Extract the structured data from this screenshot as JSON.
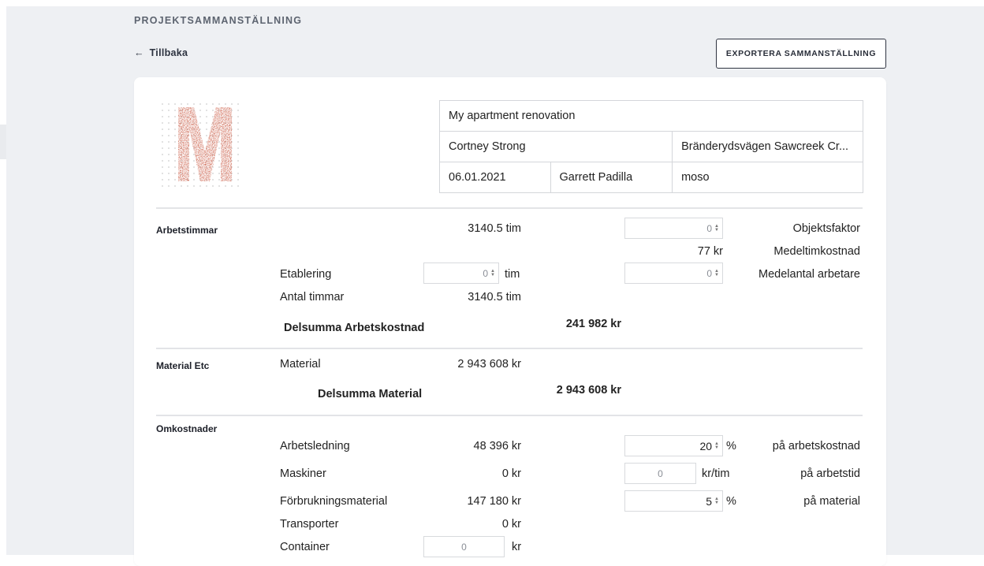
{
  "header": {
    "title": "PROJEKTSAMMANSTÄLLNING",
    "back_label": "Tillbaka",
    "export_label": "EXPORTERA SAMMANSTÄLLNING"
  },
  "colors": {
    "logo": "#c4442a",
    "background": "#eef0f3",
    "card": "#ffffff"
  },
  "project": {
    "name": "My apartment renovation",
    "client": "Cortney Strong",
    "address": "Bränderydsvägen Sawcreek Cr...",
    "date": "06.01.2021",
    "responsible": "Garrett Padilla",
    "code": "moso"
  },
  "arbetstimmar": {
    "section": "Arbetstimmar",
    "hours": "3140.5 tim",
    "objektsfaktor_value": "0",
    "objektsfaktor_label": "Objektsfaktor",
    "medeltim_value": "77 kr",
    "medeltim_label": "Medeltimkostnad",
    "etablering_label": "Etablering",
    "etablering_value": "0",
    "etablering_unit": "tim",
    "medelantal_value": "0",
    "medelantal_label": "Medelantal arbetare",
    "antal_label": "Antal timmar",
    "antal_value": "3140.5 tim",
    "subtotal_label": "Delsumma Arbetskostnad",
    "subtotal_value": "241 982 kr"
  },
  "material": {
    "section": "Material Etc",
    "label": "Material",
    "value": "2 943 608 kr",
    "subtotal_label": "Delsumma Material",
    "subtotal_value": "2 943 608 kr"
  },
  "omkostnader": {
    "section": "Omkostnader",
    "rows": [
      {
        "label": "Arbetsledning",
        "value": "48 396 kr",
        "input": "20",
        "unit": "%",
        "basis": "på arbetskostnad"
      },
      {
        "label": "Maskiner",
        "value": "0 kr",
        "input": "0",
        "unit": "kr/tim",
        "basis": "på arbetstid"
      },
      {
        "label": "Förbrukningsmaterial",
        "value": "147 180 kr",
        "input": "5",
        "unit": "%",
        "basis": "på material"
      },
      {
        "label": "Transporter",
        "value": "0 kr"
      },
      {
        "label": "Container",
        "input": "0",
        "unit": "kr"
      }
    ]
  }
}
